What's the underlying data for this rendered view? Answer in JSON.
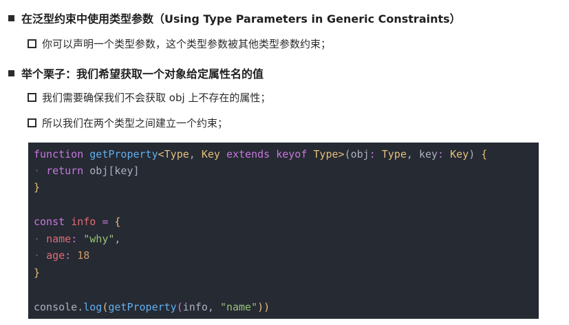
{
  "bullets": {
    "b1": "在泛型约束中使用类型参数（Using Type Parameters in Generic Constraints）",
    "b1_sub1": "你可以声明一个类型参数，这个类型参数被其他类型参数约束；",
    "b2": "举个栗子：我们希望获取一个对象给定属性名的值",
    "b2_sub1": "我们需要确保我们不会获取 obj 上不存在的属性；",
    "b2_sub2": "所以我们在两个类型之间建立一个约束；"
  },
  "code": {
    "l1": {
      "kw_function": "function",
      "fn": "getProperty",
      "lt": "<",
      "type": "Type",
      "comma1": ",",
      "key": "Key",
      "extends": "extends",
      "keyof": "keyof",
      "type2": "Type",
      "gt": ">",
      "paren": "(",
      "obj": "obj",
      "colon1": ":",
      "type3": "Type",
      "comma2": ",",
      "keyp": "key",
      "colon2": ":",
      "key2": "Key",
      "close": ")",
      "brace": "{"
    },
    "l2": {
      "ret": "return",
      "expr": "obj[key]"
    },
    "l3": {
      "brace": "}"
    },
    "l5": {
      "const": "const",
      "name": "info",
      "eq": "=",
      "brace": "{"
    },
    "l6": {
      "prop": "name",
      "colon": ":",
      "val": "\"why\"",
      "comma": ","
    },
    "l7": {
      "prop": "age",
      "colon": ":",
      "val": "18"
    },
    "l8": {
      "brace": "}"
    },
    "l10": {
      "console": "console",
      "dot": ".",
      "log": "log",
      "p1": "(",
      "fn": "getProperty",
      "p2": "(",
      "arg": "info",
      "comma": ",",
      "str": "\"name\"",
      "p3": "))"
    }
  }
}
